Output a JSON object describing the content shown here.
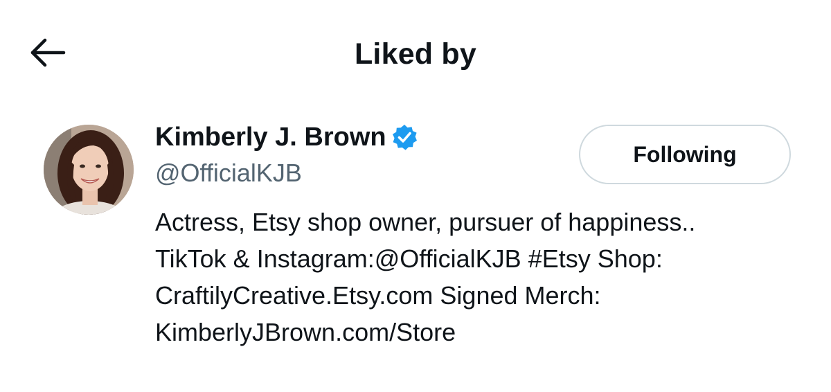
{
  "header": {
    "back_icon": "arrow-left-icon",
    "title": "Liked by"
  },
  "user": {
    "avatar_icon": "profile-photo",
    "display_name": "Kimberly J. Brown",
    "verified_icon": "verified-badge-icon",
    "verified_color": "#1d9bf0",
    "handle": "@OfficialKJB",
    "follow_button_label": "Following",
    "bio_lines": [
      "Actress, Etsy shop owner, pursuer of happiness..",
      "TikTok & Instagram:@OfficialKJB #Etsy Shop:",
      "CraftilyCreative.Etsy.com Signed Merch:",
      "KimberlyJBrown.com/Store"
    ]
  },
  "colors": {
    "text_primary": "#0f1419",
    "text_secondary": "#536471",
    "button_border": "#cfd9de",
    "background": "#ffffff"
  }
}
